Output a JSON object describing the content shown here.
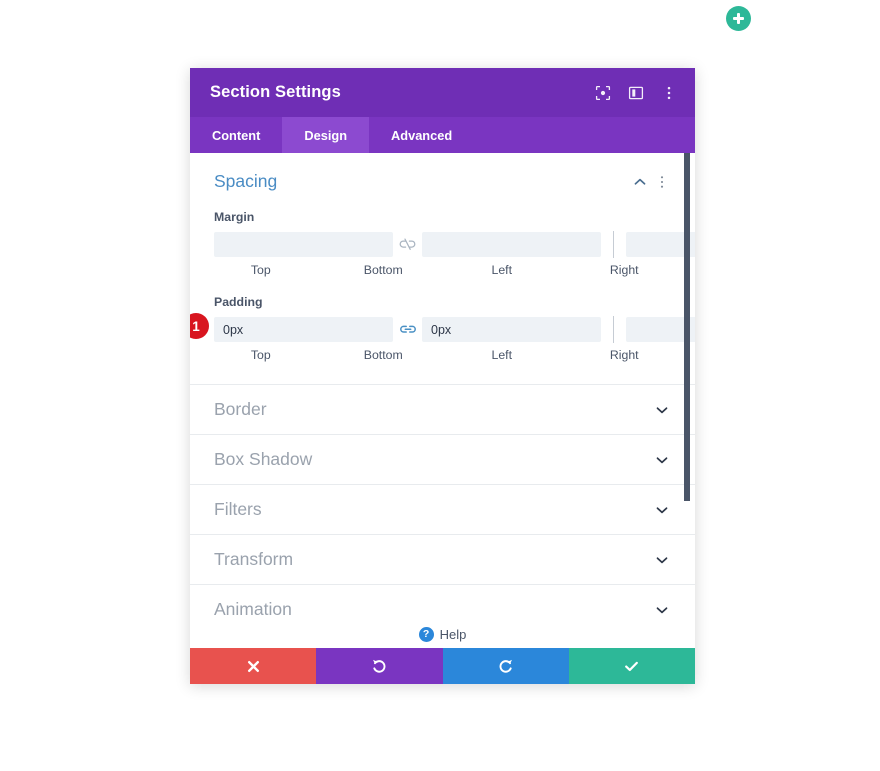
{
  "canvas": {
    "add_button_icon": "plus-icon",
    "accent_purple": "#6f2eb5",
    "accent_tab_bar": "#7a35c1",
    "accent_tab_active": "#8c4ad0",
    "accent_teal": "#2db898",
    "accent_blue": "#2b87da",
    "accent_red": "#e8524e",
    "badge_red": "#d8151f",
    "section_title_blue": "#4a8cc4",
    "input_bg": "#eef2f6"
  },
  "modal": {
    "title": "Section Settings",
    "titlebar_icons": [
      {
        "name": "focus-target-icon",
        "label": "Focus"
      },
      {
        "name": "panel-layout-icon",
        "label": "Layout"
      },
      {
        "name": "kebab-menu-icon",
        "label": "More options"
      }
    ],
    "tabs": [
      {
        "label": "Content",
        "active": false
      },
      {
        "label": "Design",
        "active": true
      },
      {
        "label": "Advanced",
        "active": false
      }
    ]
  },
  "spacing": {
    "title": "Spacing",
    "collapse_icon": "chevron-up-icon",
    "options_icon": "kebab-menu-icon",
    "margin": {
      "label": "Margin",
      "link_icon": "chain-broken-icon",
      "linked": false,
      "fields": [
        {
          "caption": "Top",
          "value": "",
          "placeholder": ""
        },
        {
          "caption": "Bottom",
          "value": "",
          "placeholder": ""
        },
        {
          "caption": "Left",
          "value": "",
          "placeholder": ""
        },
        {
          "caption": "Right",
          "value": "",
          "placeholder": ""
        }
      ]
    },
    "padding": {
      "label": "Padding",
      "badge": "1",
      "link_icon_left": "chain-linked-icon",
      "link_icon_right": "chain-broken-icon",
      "fields": [
        {
          "caption": "Top",
          "value": "0px",
          "placeholder": ""
        },
        {
          "caption": "Bottom",
          "value": "0px",
          "placeholder": ""
        },
        {
          "caption": "Left",
          "value": "",
          "placeholder": ""
        },
        {
          "caption": "Right",
          "value": "",
          "placeholder": ""
        }
      ]
    }
  },
  "collapsed_sections": [
    {
      "label": "Border",
      "chevron": "chevron-down-icon"
    },
    {
      "label": "Box Shadow",
      "chevron": "chevron-down-icon"
    },
    {
      "label": "Filters",
      "chevron": "chevron-down-icon"
    },
    {
      "label": "Transform",
      "chevron": "chevron-down-icon"
    },
    {
      "label": "Animation",
      "chevron": "chevron-down-icon"
    }
  ],
  "help": {
    "label": "Help",
    "icon": "question-mark-icon"
  },
  "footer": {
    "buttons": [
      {
        "name": "cancel-button",
        "icon": "close-x-icon",
        "color": "#e8524e"
      },
      {
        "name": "undo-button",
        "icon": "undo-arrow-icon",
        "color": "#7a35c1"
      },
      {
        "name": "redo-button",
        "icon": "redo-arrow-icon",
        "color": "#2b87da"
      },
      {
        "name": "save-button",
        "icon": "checkmark-icon",
        "color": "#2db898"
      }
    ]
  }
}
